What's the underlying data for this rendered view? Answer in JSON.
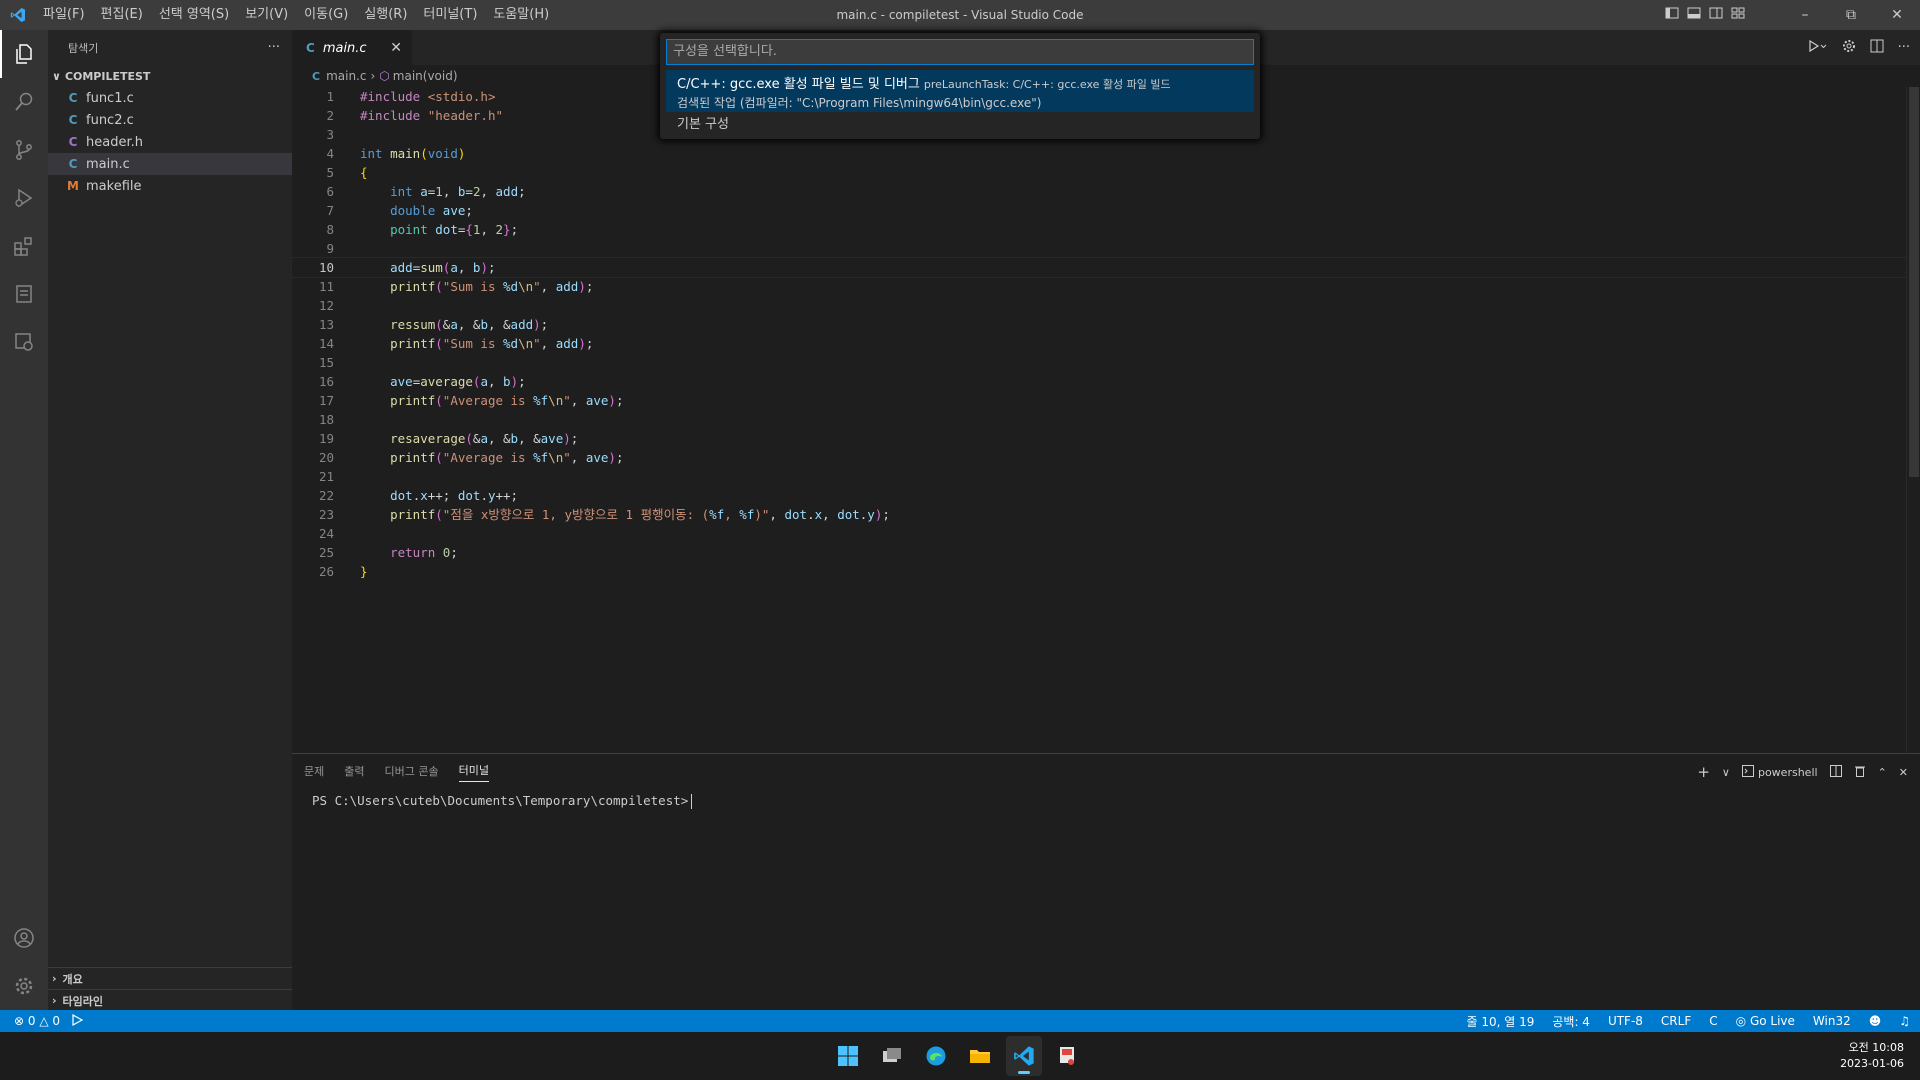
{
  "titlebar": {
    "menu": [
      "파일(F)",
      "편집(E)",
      "선택 영역(S)",
      "보기(V)",
      "이동(G)",
      "실행(R)",
      "터미널(T)",
      "도움말(H)"
    ],
    "title": "main.c - compiletest - Visual Studio Code"
  },
  "sidebar": {
    "title": "탐색기",
    "folder": "COMPILETEST",
    "files": [
      {
        "name": "func1.c",
        "icon": "C",
        "color": "#519aba"
      },
      {
        "name": "func2.c",
        "icon": "C",
        "color": "#519aba"
      },
      {
        "name": "header.h",
        "icon": "C",
        "color": "#a074c4"
      },
      {
        "name": "main.c",
        "icon": "C",
        "color": "#519aba"
      },
      {
        "name": "makefile",
        "icon": "M",
        "color": "#e37933"
      }
    ],
    "outline": "개요",
    "timeline": "타임라인"
  },
  "editor": {
    "tab": "main.c",
    "breadcrumb_file": "main.c",
    "breadcrumb_symbol": "main(void)",
    "current_line": 10,
    "line_count": 26
  },
  "quickpick": {
    "placeholder": "구성을 선택합니다.",
    "item1_label": "C/C++: gcc.exe 활성 파일 빌드 및 디버그",
    "item1_desc": "preLaunchTask: C/C++: gcc.exe 활성 파일 빌드",
    "item1_detail": "검색된 작업 (컴파일러: \"C:\\Program Files\\mingw64\\bin\\gcc.exe\")",
    "item2_label": "기본 구성"
  },
  "panel": {
    "tabs": [
      "문제",
      "출력",
      "디버그 콘솔",
      "터미널"
    ],
    "active_tab": "터미널",
    "shell": "powershell",
    "prompt": "PS C:\\Users\\cuteb\\Documents\\Temporary\\compiletest>"
  },
  "statusbar": {
    "errors": "0",
    "warnings": "0",
    "position": "줄 10, 열 19",
    "spaces": "공백: 4",
    "encoding": "UTF-8",
    "eol": "CRLF",
    "language": "C",
    "golive": "Go Live",
    "platform": "Win32"
  },
  "taskbar": {
    "time": "오전 10:08",
    "date": "2023-01-06"
  },
  "colors": {
    "accent": "#007acc",
    "selection": "#04395e"
  }
}
